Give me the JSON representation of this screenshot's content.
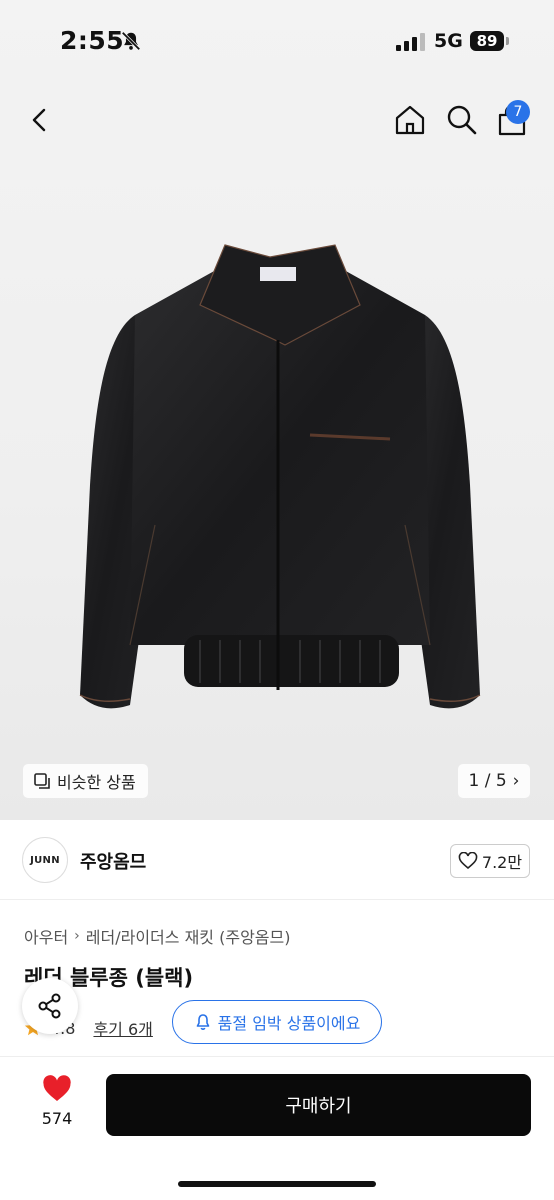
{
  "status_bar": {
    "time": "2:55",
    "network": "5G",
    "battery": "89"
  },
  "nav": {
    "cart_count": "7"
  },
  "hero": {
    "similar_label": "비슷한 상품",
    "pager": "1 / 5"
  },
  "seller": {
    "logo_text": "JUNN",
    "name": "주앙옴므",
    "likes": "7.2만"
  },
  "breadcrumb": {
    "category": "아우터",
    "subcategory": "레더/라이더스 재킷 (주앙옴므)"
  },
  "product": {
    "title": "레더 블루종 (블랙)",
    "rating": "4.8",
    "reviews": "후기 6개"
  },
  "soldout_notice": "품절 임박 상품이에요",
  "bottom": {
    "like_count": "574",
    "buy_label": "구매하기"
  },
  "colors": {
    "accent": "#2a73e8",
    "like": "#e8202a",
    "buy_bg": "#0a0a0a",
    "star": "#f5a623"
  }
}
